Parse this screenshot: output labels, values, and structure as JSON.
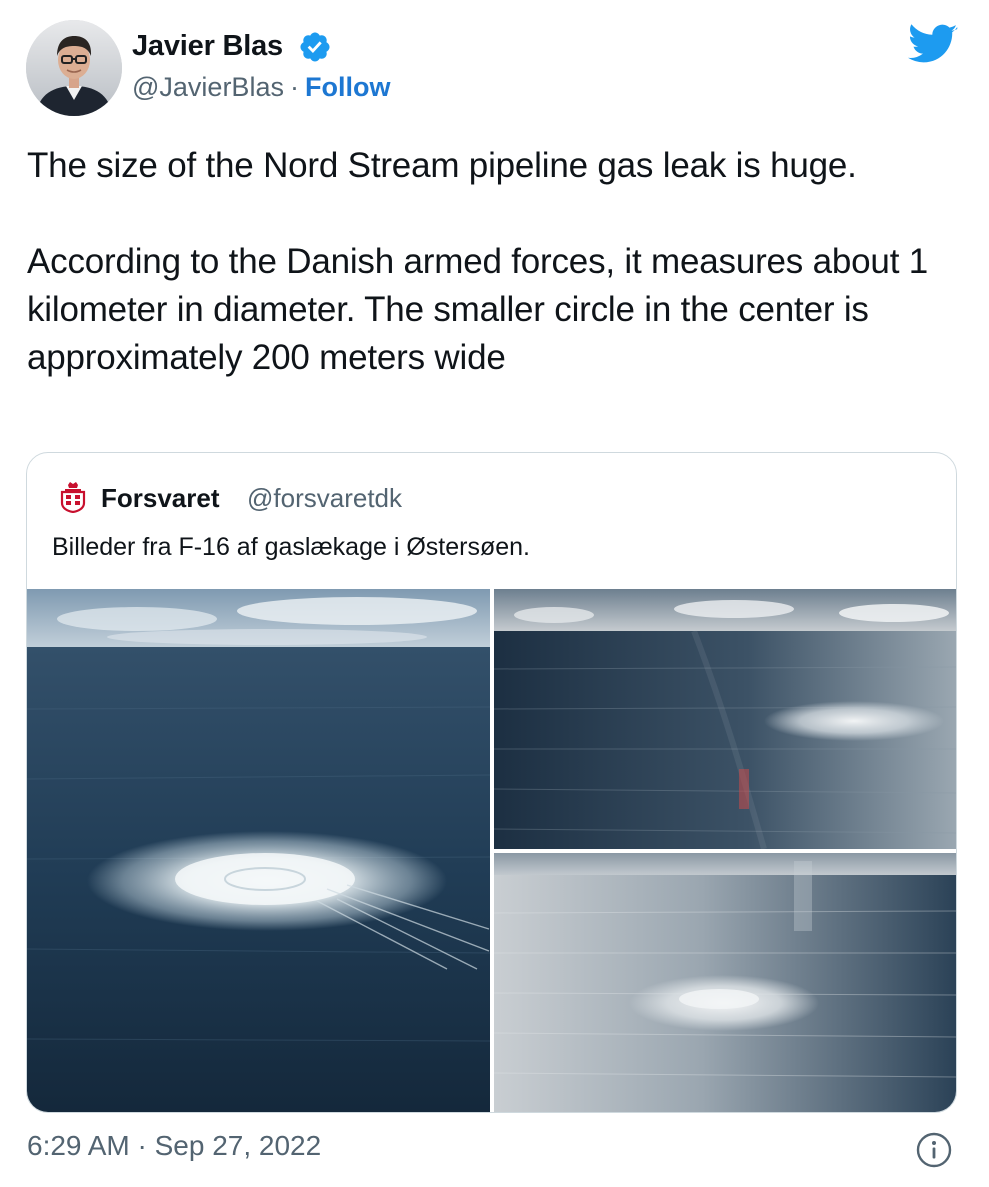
{
  "author": {
    "name": "Javier Blas",
    "handle": "@JavierBlas",
    "separator": "·",
    "follow_label": "Follow",
    "verified": true
  },
  "tweet": {
    "paragraphs": [
      "The size of the Nord Stream pipeline gas leak is huge.",
      "According to the Danish armed forces, it measures about 1 kilometer in diameter. The smaller circle in the center is approximately 200 meters wide"
    ]
  },
  "quoted": {
    "name": "Forsvaret",
    "handle": "@forsvaretdk",
    "text": "Billeder fra F-16 af gaslækage i Østersøen.",
    "photo_count": 3
  },
  "footer": {
    "timestamp": "6:29 AM · Sep 27, 2022"
  },
  "icons": {
    "twitter_logo": "twitter-bird-icon",
    "verified_badge": "verified-badge-icon",
    "info": "info-icon",
    "org_logo": "forsvaret-crest-icon"
  },
  "colors": {
    "brand_blue": "#1d9bf0",
    "link_blue": "#1d77d2",
    "text": "#0f1419",
    "secondary": "#536471",
    "border": "#cfd9de",
    "crest_red": "#c8102e"
  }
}
